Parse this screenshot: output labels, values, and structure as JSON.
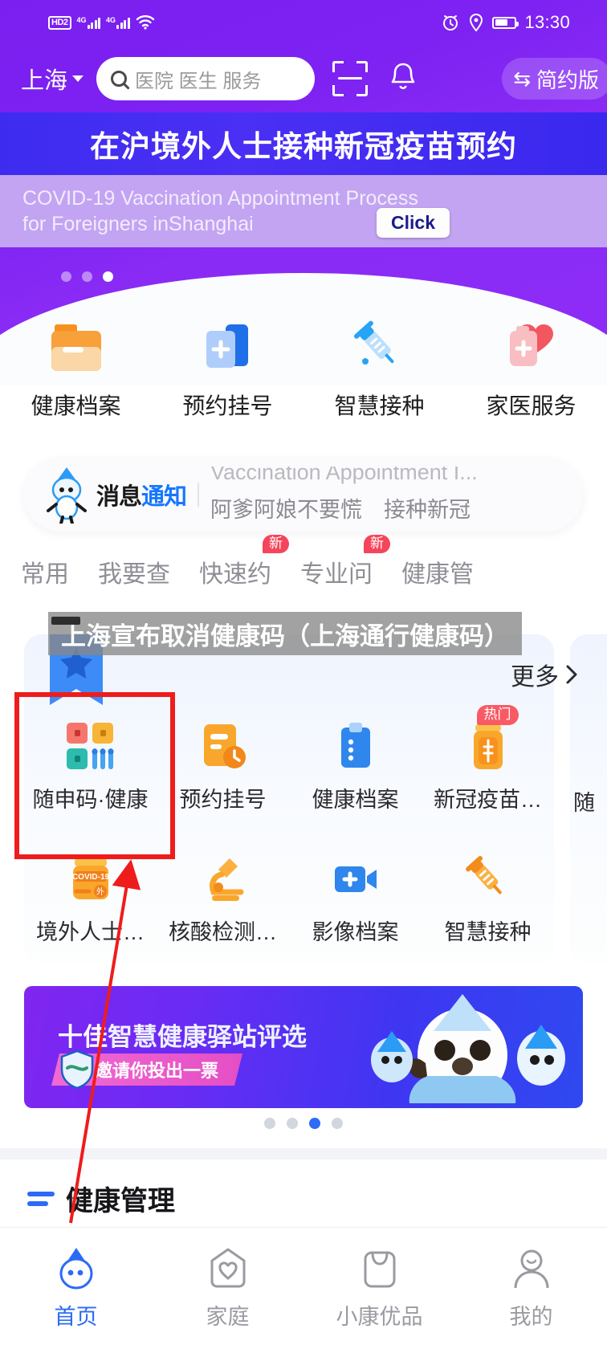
{
  "status_bar": {
    "hd_label": "HD",
    "hd_sub": "2",
    "network_1": "4G",
    "network_2": "4G",
    "wifi_icon": "wifi-icon",
    "alarm_icon": "alarm-icon",
    "location_icon": "location-pin-icon",
    "battery_icon": "battery-icon",
    "time": "13:30"
  },
  "header": {
    "city": "上海",
    "city_chevron_icon": "chevron-down-icon",
    "search_placeholder": "医院 医生 服务",
    "search_icon": "search-icon",
    "scan_icon": "scan-code-icon",
    "bell_icon": "bell-icon",
    "simple_mode_label": "简约版",
    "simple_mode_icon": "switch-icon"
  },
  "banner": {
    "title_cn": "在沪境外人士接种新冠疫苗预约",
    "subtitle_en_line1": "COVID-19 Vaccination Appointment Process",
    "subtitle_en_line2": "for Foreigners inShanghai",
    "click_label": "Click",
    "dots": 3,
    "active_dot": 3
  },
  "quick_actions": [
    {
      "label": "健康档案",
      "icon": "health-record-folder-icon"
    },
    {
      "label": "预约挂号",
      "icon": "appointment-card-icon"
    },
    {
      "label": "智慧接种",
      "icon": "syringe-icon"
    },
    {
      "label": "家医服务",
      "icon": "heart-plus-icon"
    }
  ],
  "notice": {
    "mascot_icon": "mascot-bird-icon",
    "title_black": "消息",
    "title_blue": "通知",
    "scroll_line1": "Vaccination Appointment I...",
    "scroll_line2": "阿爹阿娘不要慌　接种新冠"
  },
  "tabs": [
    {
      "label": "常用",
      "badge": ""
    },
    {
      "label": "我要查",
      "badge": ""
    },
    {
      "label": "快速约",
      "badge": "新"
    },
    {
      "label": "专业问",
      "badge": "新"
    },
    {
      "label": "健康管",
      "badge": ""
    }
  ],
  "overlay": {
    "watermark_text": "上海宣布取消健康码（上海通行健康码）"
  },
  "service_card": {
    "ribbon_icon": "star-ribbon-icon",
    "more_label": "更多",
    "more_chevron_icon": "chevron-right-icon",
    "items": [
      {
        "label": "随申码·健康",
        "icon": "qr-health-code-icon",
        "badge": ""
      },
      {
        "label": "预约挂号",
        "icon": "appointment-doc-clock-icon",
        "badge": ""
      },
      {
        "label": "健康档案",
        "icon": "clipboard-icon",
        "badge": ""
      },
      {
        "label": "新冠疫苗…",
        "icon": "vaccine-bottle-icon",
        "badge": "热门"
      },
      {
        "label": "境外人士…",
        "icon": "covid19-bottle-icon",
        "badge": ""
      },
      {
        "label": "核酸检测…",
        "icon": "microscope-icon",
        "badge": ""
      },
      {
        "label": "影像档案",
        "icon": "video-plus-icon",
        "badge": ""
      },
      {
        "label": "智慧接种",
        "icon": "syringe-orange-icon",
        "badge": ""
      }
    ],
    "peek_label": "随"
  },
  "annotation": {
    "highlight_box_color": "#ef1c1c",
    "arrow_color": "#ef1c1c",
    "arrow_target": "随申码·健康"
  },
  "promo": {
    "title_highlight": "十佳",
    "title_rest": "智慧健康驿站评选",
    "pill_label": "邀请你投出一票",
    "shield_icon": "shield-icon",
    "mascot_icon": "mascot-bird-icon",
    "dots": 4,
    "active_dot": 3
  },
  "section": {
    "title": "健康管理",
    "bar_color": "#2b6bf5"
  },
  "bottom_nav": [
    {
      "label": "首页",
      "icon": "home-mascot-icon",
      "active": true
    },
    {
      "label": "家庭",
      "icon": "family-house-heart-icon",
      "active": false
    },
    {
      "label": "小康优品",
      "icon": "shopping-bag-icon",
      "active": false
    },
    {
      "label": "我的",
      "icon": "person-icon",
      "active": false
    }
  ]
}
